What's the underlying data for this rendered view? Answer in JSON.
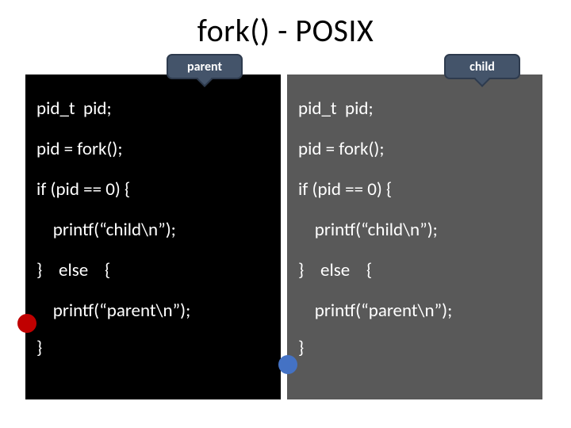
{
  "title": "fork() - POSIX",
  "labels": {
    "parent": "parent",
    "child": "child"
  },
  "code": {
    "l1": "pid_t  pid;",
    "l2": "pid = fork();",
    "l3": "if (pid == 0) {",
    "l4": "    printf(“child\\n”);",
    "l5": "}    else    {",
    "l6": "    printf(“parent\\n”);",
    "l7": "}"
  },
  "colors": {
    "parent_bg": "#000000",
    "child_bg": "#595959",
    "tag_bg": "#44546a",
    "marker_red": "#c00000",
    "marker_blue": "#4472c4"
  }
}
